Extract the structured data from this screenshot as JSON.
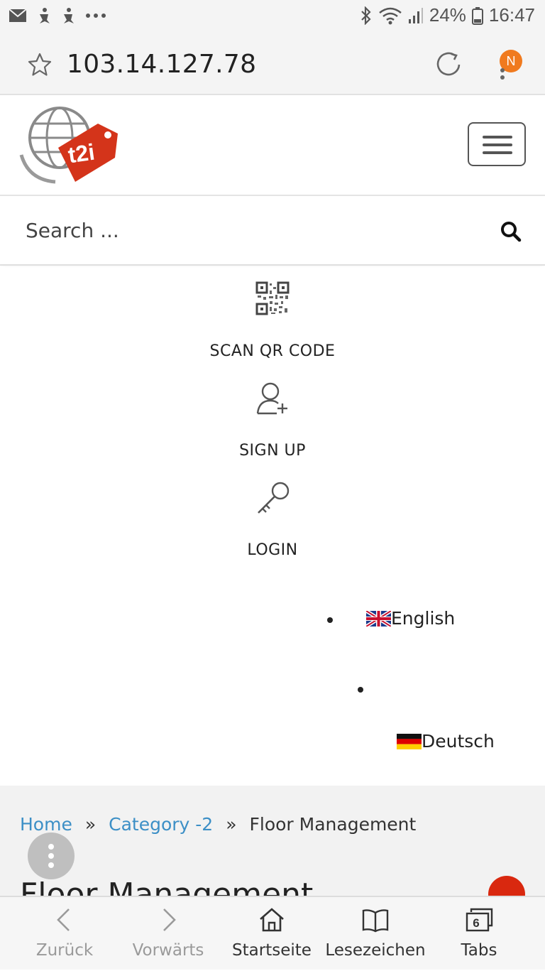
{
  "status_bar": {
    "battery": "24%",
    "time": "16:47"
  },
  "address_bar": {
    "url": "103.14.127.78",
    "profile_initial": "N"
  },
  "site_header": {
    "logo_text": "t2i"
  },
  "search": {
    "placeholder": "Search ..."
  },
  "menu": {
    "items": [
      {
        "label": "SCAN QR CODE",
        "icon": "qr-code-icon"
      },
      {
        "label": "SIGN UP",
        "icon": "user-plus-icon"
      },
      {
        "label": "LOGIN",
        "icon": "key-icon"
      }
    ],
    "languages": [
      {
        "label": "English",
        "flag": "uk-flag-icon"
      },
      {
        "label": "Deutsch",
        "flag": "germany-flag-icon"
      }
    ]
  },
  "breadcrumb": {
    "home": "Home",
    "category": "Category -2",
    "current": "Floor Management",
    "separator": "»"
  },
  "page": {
    "title": "Floor Management"
  },
  "bottom_nav": {
    "items": [
      {
        "label": "Zurück",
        "icon": "back-arrow-icon",
        "enabled": false
      },
      {
        "label": "Vorwärts",
        "icon": "forward-arrow-icon",
        "enabled": false
      },
      {
        "label": "Startseite",
        "icon": "home-icon",
        "enabled": true
      },
      {
        "label": "Lesezeichen",
        "icon": "bookmarks-icon",
        "enabled": true
      },
      {
        "label": "Tabs",
        "icon": "tabs-icon",
        "enabled": true,
        "count": "6"
      }
    ]
  },
  "colors": {
    "link": "#3c8fc6",
    "accent_orange": "#f07a1e",
    "fab_red": "#d9280f"
  }
}
